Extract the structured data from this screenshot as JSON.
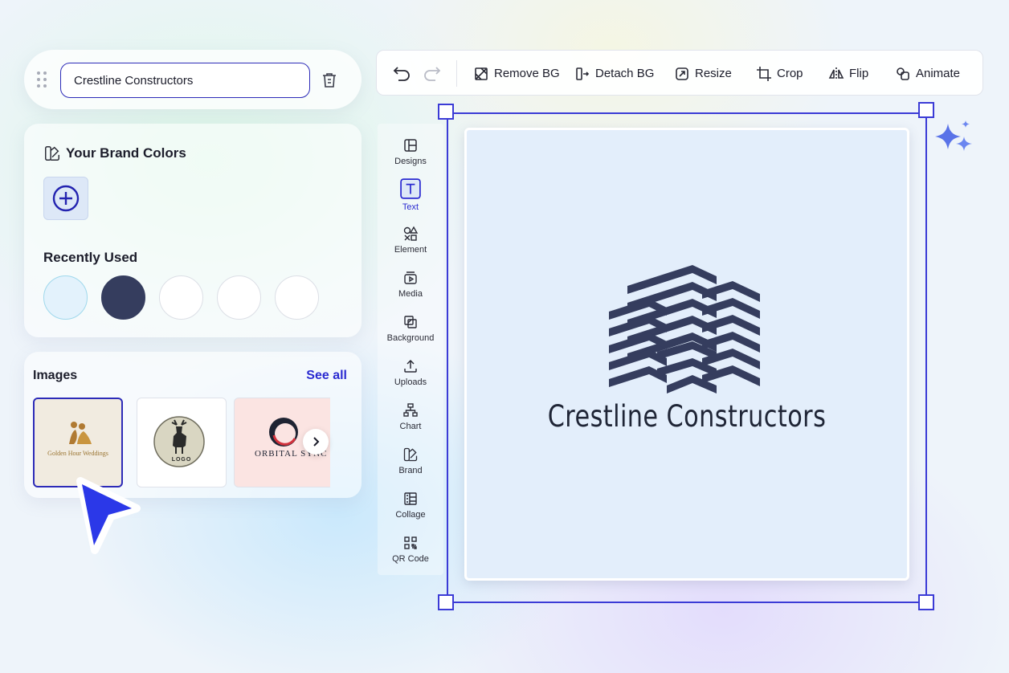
{
  "project": {
    "name_value": "Crestline Constructors"
  },
  "brand_colors": {
    "title": "Your Brand Colors",
    "recently_used_title": "Recently Used",
    "recent_swatches": [
      "#e3f2fc",
      "#353d5e",
      "#ffffff",
      "#ffffff",
      "#ffffff"
    ]
  },
  "images": {
    "title": "Images",
    "see_all": "See all",
    "items": [
      {
        "label": "Golden Hour Weddings",
        "bg": "#f1ebe0"
      },
      {
        "label": "LOGO",
        "bg": "#ffffff"
      },
      {
        "label": "ORBITAL SYNC",
        "bg": "#fbe4e2"
      }
    ]
  },
  "toolbar": {
    "remove_bg": "Remove BG",
    "detach_bg": "Detach BG",
    "resize": "Resize",
    "crop": "Crop",
    "flip": "Flip",
    "animate": "Animate"
  },
  "rail": [
    {
      "label": "Designs",
      "icon": "layout-icon"
    },
    {
      "label": "Text",
      "icon": "text-icon",
      "active": true
    },
    {
      "label": "Element",
      "icon": "shapes-icon"
    },
    {
      "label": "Media",
      "icon": "media-icon"
    },
    {
      "label": "Background",
      "icon": "background-icon"
    },
    {
      "label": "Uploads",
      "icon": "upload-icon"
    },
    {
      "label": "Chart",
      "icon": "chart-icon"
    },
    {
      "label": "Brand",
      "icon": "brand-icon"
    },
    {
      "label": "Collage",
      "icon": "collage-icon"
    },
    {
      "label": "QR Code",
      "icon": "qr-code-icon"
    }
  ],
  "canvas": {
    "logo_text": "Crestline Constructors",
    "background": "#e3eefb",
    "logo_color": "#353d5e"
  },
  "colors": {
    "accent": "#2b2bd1",
    "selection": "#3b3bd6"
  }
}
